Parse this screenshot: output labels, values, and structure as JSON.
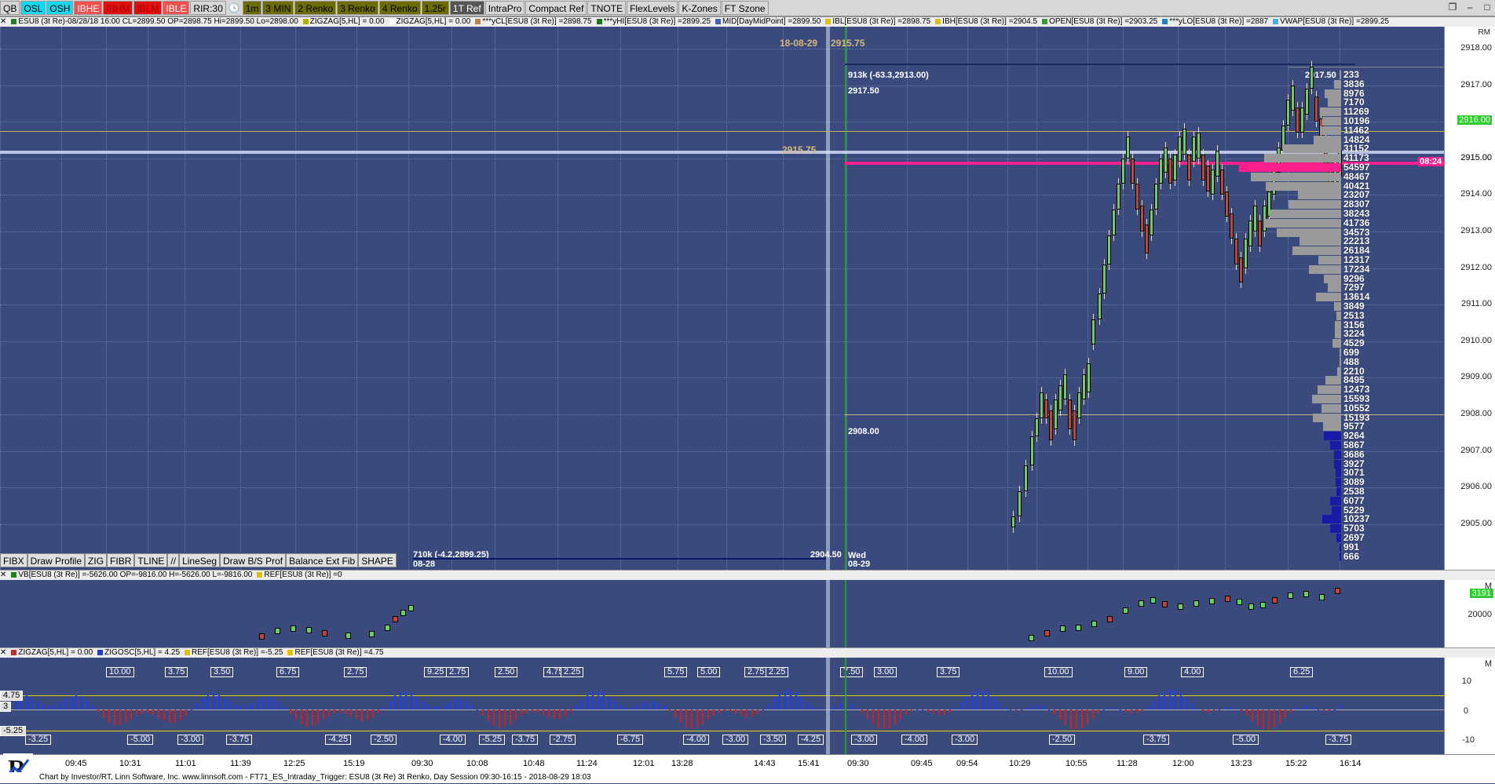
{
  "toolbar": {
    "buttons": [
      {
        "label": "QB",
        "bg": "#d7d7d7",
        "fg": "#000"
      },
      {
        "label": "OSL",
        "bg": "#11d8ee",
        "fg": "#000"
      },
      {
        "label": "OSH",
        "bg": "#11d8ee",
        "fg": "#000"
      },
      {
        "label": "IBHE",
        "bg": "#f05050",
        "fg": "#fff"
      },
      {
        "label": "IBHM",
        "bg": "#e01010",
        "fg": "#a00"
      },
      {
        "label": "IBLM",
        "bg": "#e01010",
        "fg": "#a00"
      },
      {
        "label": "IBLE",
        "bg": "#f05050",
        "fg": "#fff"
      },
      {
        "label": "RIR:30",
        "bg": "#d7d7d7",
        "fg": "#000"
      },
      {
        "label": "1m",
        "bg": "#6c6c00",
        "fg": "#000"
      },
      {
        "label": "3 MIN",
        "bg": "#6c6c00",
        "fg": "#000"
      },
      {
        "label": "2 Renko",
        "bg": "#6c6c00",
        "fg": "#000"
      },
      {
        "label": "3 Renko",
        "bg": "#6c6c00",
        "fg": "#000"
      },
      {
        "label": "4 Renko",
        "bg": "#6c6c00",
        "fg": "#000"
      },
      {
        "label": "1.25r",
        "bg": "#6c6c00",
        "fg": "#000"
      },
      {
        "label": "1T Ref",
        "bg": "#555",
        "fg": "#fff"
      },
      {
        "label": "IntraPro",
        "bg": "#d7d7d7",
        "fg": "#000"
      },
      {
        "label": "Compact Ref",
        "bg": "#d7d7d7",
        "fg": "#000"
      },
      {
        "label": "TNOTE",
        "bg": "#d7d7d7",
        "fg": "#000"
      },
      {
        "label": "FlexLevels",
        "bg": "#d7d7d7",
        "fg": "#000"
      },
      {
        "label": "K-Zones",
        "bg": "#d7d7d7",
        "fg": "#000"
      },
      {
        "label": "FT Szone",
        "bg": "#d7d7d7",
        "fg": "#000"
      }
    ]
  },
  "study_bar_1": [
    {
      "text": "ESU8 (3t Re)-08/28/18 16:00 CL=2899.50 OP=2898.75 Hi=2899.50 Lo=2898.00",
      "color": "#2a7a2a"
    },
    {
      "text": "ZIGZAG[5,HL] = 0.00",
      "color": "#b0b000"
    },
    {
      "text": "ZIGZAG[5,HL] = 0.00",
      "color": "#ffffff"
    },
    {
      "text": "***yCL[ESU8 (3t Re)] =2898.75",
      "color": "#c08040"
    },
    {
      "text": "***yHI[ESU8 (3t Re)] =2899.25",
      "color": "#207020"
    },
    {
      "text": "MID[DayMidPoint] =2899.50",
      "color": "#4060c0"
    },
    {
      "text": "IBL[ESU8 (3t Re)] =2898.75",
      "color": "#e0c000"
    },
    {
      "text": "IBH[ESU8 (3t Re)] =2904.5",
      "color": "#e0c000"
    },
    {
      "text": "OPEN[ESU8 (3t Re)] =2903.25",
      "color": "#30a030"
    },
    {
      "text": "***yLO[ESU8 (3t Re)] =2887",
      "color": "#2080c0"
    },
    {
      "text": "VWAP[ESU8 (3t Re)] =2899.25",
      "color": "#40b0e0"
    }
  ],
  "study_bar_2": [
    {
      "text": "VB[ESU8 (3t Re)] =-5626.00 OP=-9816.00 H=-5626.00 L=-9816.00",
      "color": "#208020"
    },
    {
      "text": "REF[ESU8 (3t Re)] =0",
      "color": "#e0c000"
    }
  ],
  "study_bar_3": [
    {
      "text": "ZIGZAG[5,HL] = 0.00",
      "color": "#c03030"
    },
    {
      "text": "ZIGOSC[5,HL] = 4.25",
      "color": "#2040c0"
    },
    {
      "text": "REF[ESU8 (3t Re)] =-5.25",
      "color": "#e0c000"
    },
    {
      "text": "REF[ESU8 (3t Re)] =4.75",
      "color": "#e0c000"
    }
  ],
  "price_axis": {
    "rm_label": "RM",
    "ticks": [
      "2918.00",
      "2917.00",
      "2916.00",
      "2915.00",
      "2914.00",
      "2913.00",
      "2912.00",
      "2911.00",
      "2910.00",
      "2909.00",
      "2908.00",
      "2907.00",
      "2906.00",
      "2905.00"
    ],
    "current_price": "2916.00",
    "mid_price": "2915.00"
  },
  "price_annotations": {
    "top_date": "18-08-29",
    "top_price": "2915.75",
    "ref_2915_75": "2915.75",
    "box_label": "913k (-63.3,2913.00)",
    "high_label": "2917.50",
    "high_label_left": "2917.50",
    "level_2908": "2908.00",
    "low_box_label": "710k (-4.2,2899.25)",
    "low_box_date": "08-28",
    "low_right": "2904.50",
    "wed_label": "Wed",
    "wed_date": "08-29",
    "pink_time": "08:24"
  },
  "volume_profile": [
    "233",
    "3836",
    "8976",
    "7170",
    "11269",
    "10196",
    "11462",
    "14824",
    "31152",
    "41173",
    "54597",
    "48467",
    "40421",
    "23207",
    "28307",
    "38243",
    "41736",
    "34573",
    "22213",
    "26184",
    "12317",
    "17234",
    "9296",
    "7297",
    "13614",
    "3849",
    "2513",
    "3156",
    "3224",
    "4529",
    "699",
    "488",
    "2210",
    "8495",
    "12473",
    "15593",
    "10552",
    "15193",
    "9577",
    "9264",
    "5867",
    "3686",
    "3927",
    "3071",
    "3089",
    "2538",
    "6077",
    "5229",
    "10237",
    "5703",
    "2697",
    "991",
    "666"
  ],
  "draw_tools": [
    "FIBX",
    "Draw Profile",
    "ZIG",
    "FIBR",
    "TLINE",
    "//",
    "LineSeg",
    "Draw B/S Prof",
    "Balance Ext Fib",
    "SHAPE"
  ],
  "vb_axis": {
    "value": "3191",
    "label": "20000",
    "m": "M"
  },
  "osc_axis": {
    "ticks": [
      "10",
      "0",
      "-10"
    ],
    "m": "M"
  },
  "osc_left": {
    "upper": "4.75",
    "lower": "-5.25",
    "mid": "3"
  },
  "osc_labels_top": [
    "10.00",
    "3.75",
    "3.50",
    "6.75",
    "2.75",
    "9.25",
    "2.75",
    "2.50",
    "4.75",
    "2.25",
    "5.75",
    "5.00",
    "2.75",
    "2.25",
    "7.50",
    "3.00",
    "3.75",
    "10.00",
    "9.00",
    "4.00",
    "6.25"
  ],
  "osc_labels_bottom": [
    "-3.25",
    "-5.00",
    "-3.00",
    "-3.75",
    "-4.25",
    "-2.50",
    "-4.00",
    "-5.25",
    "-3.75",
    "-2.75",
    "-6.75",
    "-4.00",
    "-3.00",
    "-3.50",
    "-4.25",
    "-3.00",
    "-4.00",
    "-3.00",
    "-2.50",
    "-3.75",
    "-5.00",
    "-3.75"
  ],
  "time_axis": [
    "09:45",
    "10:31",
    "11:01",
    "11:39",
    "12:25",
    "15:19",
    "09:30",
    "10:08",
    "10:48",
    "11:24",
    "12:01",
    "13:28",
    "14:43",
    "15:41",
    "09:30",
    "09:45",
    "09:54",
    "10:29",
    "10:55",
    "11:28",
    "12:00",
    "13:23",
    "15:22",
    "16:14"
  ],
  "footer": "Chart by Investor/RT, Linn Software, Inc. www.linnsoft.com - FT71_ES_Intraday_Trigger: ESU8 (3t Re) 3t Renko, Day Session 09:30-16:15 - 2018-08-29 18:03",
  "colors": {
    "background": "#3b4a7c",
    "up": "#5cd65c",
    "down": "#d43c3c",
    "pink": "#ff1f8f",
    "profile_gray": "#9a9a9a",
    "profile_blue": "#1a1aa8"
  }
}
